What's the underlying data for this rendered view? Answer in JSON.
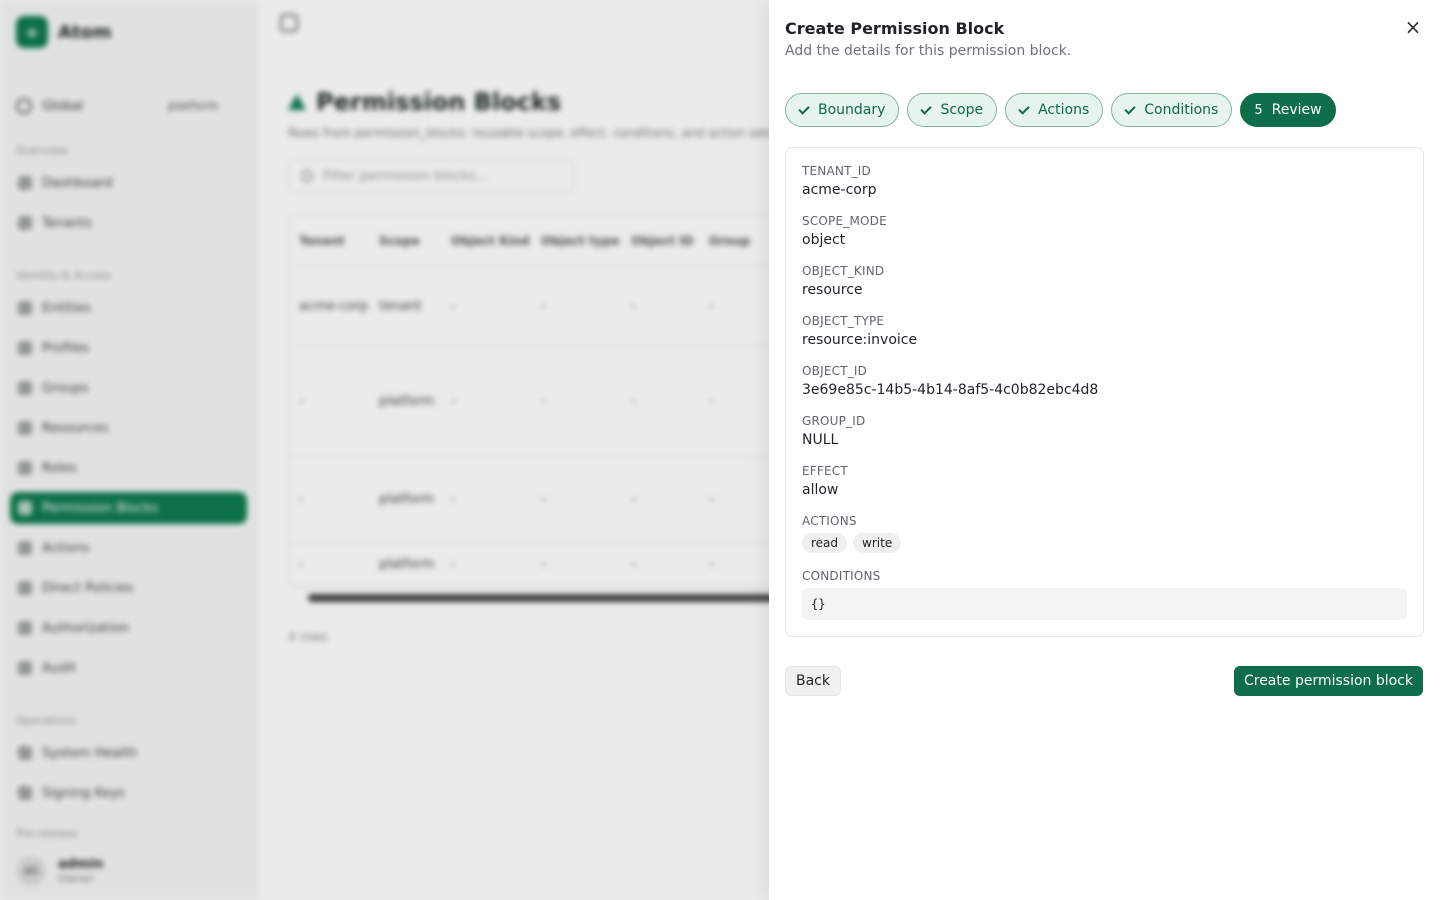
{
  "background": {
    "brand": {
      "logo_glyph": "+",
      "name": "Atom"
    },
    "scope": {
      "label": "Global",
      "value": "platform"
    },
    "sections": [
      {
        "title": "Overview",
        "items": [
          "Dashboard",
          "Tenants"
        ]
      },
      {
        "title": "Identity & Access",
        "items": [
          "Entities",
          "Profiles",
          "Groups",
          "Resources",
          "Roles",
          "Permission Blocks",
          "Actions",
          "Direct Policies",
          "Authorization",
          "Audit"
        ]
      },
      {
        "title": "Operations",
        "items": [
          "System Health",
          "Signing Keys"
        ]
      }
    ],
    "active_item": "Permission Blocks",
    "user": {
      "footer_label": "Pre-release",
      "initials": "AD",
      "name": "admin",
      "role": "Owner"
    },
    "page": {
      "title": "Permission Blocks",
      "subtitle": "Rows from permission_blocks: reusable scope, effect, conditions, and action sets",
      "filter_placeholder": "Filter permission blocks...",
      "columns": [
        "Tenant",
        "Scope",
        "Object Kind",
        "Object type",
        "Object ID",
        "Group"
      ],
      "rows": [
        [
          "acme-corp",
          "tenant",
          "-",
          "-",
          "-",
          "-"
        ],
        [
          "-",
          "platform",
          "-",
          "-",
          "-",
          "-"
        ],
        [
          "-",
          "platform",
          "-",
          "-",
          "-",
          "-"
        ],
        [
          "-",
          "platform",
          "-",
          "-",
          "-",
          "-"
        ]
      ],
      "count": "4 rows"
    }
  },
  "panel": {
    "title": "Create Permission Block",
    "description": "Add the details for this permission block.",
    "close_glyph": "×",
    "steps": [
      {
        "label": "Boundary",
        "state": "done"
      },
      {
        "label": "Scope",
        "state": "done"
      },
      {
        "label": "Actions",
        "state": "done"
      },
      {
        "label": "Conditions",
        "state": "done"
      },
      {
        "label": "Review",
        "number": "5",
        "state": "current"
      }
    ],
    "review": {
      "tenant_id": {
        "label": "TENANT_ID",
        "value": "acme-corp"
      },
      "scope_mode": {
        "label": "SCOPE_MODE",
        "value": "object"
      },
      "object_kind": {
        "label": "OBJECT_KIND",
        "value": "resource"
      },
      "object_type": {
        "label": "OBJECT_TYPE",
        "value": "resource:invoice"
      },
      "object_id": {
        "label": "OBJECT_ID",
        "value": "3e69e85c-14b5-4b14-8af5-4c0b82ebc4d8"
      },
      "group_id": {
        "label": "GROUP_ID",
        "value": "NULL"
      },
      "effect": {
        "label": "EFFECT",
        "value": "allow"
      },
      "actions": {
        "label": "ACTIONS",
        "values": [
          "read",
          "write"
        ]
      },
      "conditions": {
        "label": "CONDITIONS",
        "value": "{}"
      }
    },
    "back_label": "Back",
    "submit_label": "Create permission block"
  },
  "colors": {
    "accent": "#0e6e4a",
    "accent_light": "#e7f3ed"
  }
}
